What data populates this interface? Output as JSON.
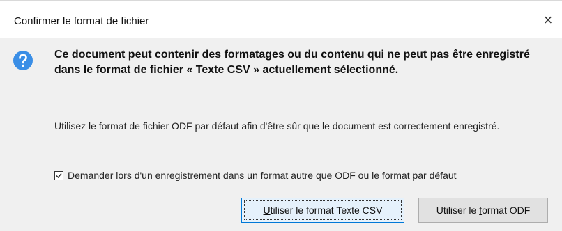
{
  "window": {
    "title": "Confirmer le format de fichier",
    "close_symbol": "×"
  },
  "icons": {
    "dialog_icon": "question-icon",
    "close": "close-icon",
    "checkbox": "check-icon"
  },
  "message": {
    "primary": "Ce document peut contenir des formatages ou du contenu qui ne peut pas être enregistré dans le format de fichier « Texte CSV » actuellement sélectionné.",
    "secondary": "Utilisez le format de fichier ODF par défaut afin d'être sûr que le document est correctement enregistré."
  },
  "checkbox": {
    "checked": true,
    "label_first": "D",
    "label_rest": "emander lors d'un enregistrement dans un format autre que ODF ou le format par défaut"
  },
  "buttons": {
    "use_csv_first": "U",
    "use_csv_rest": "tiliser le format Texte CSV",
    "use_odf_before": "Utiliser le ",
    "use_odf_mnemonic": "f",
    "use_odf_after": "ormat ODF"
  },
  "colors": {
    "accent": "#0078d7",
    "icon_blue": "#3a8ee6",
    "dialog_bg": "#f0f0f0"
  }
}
